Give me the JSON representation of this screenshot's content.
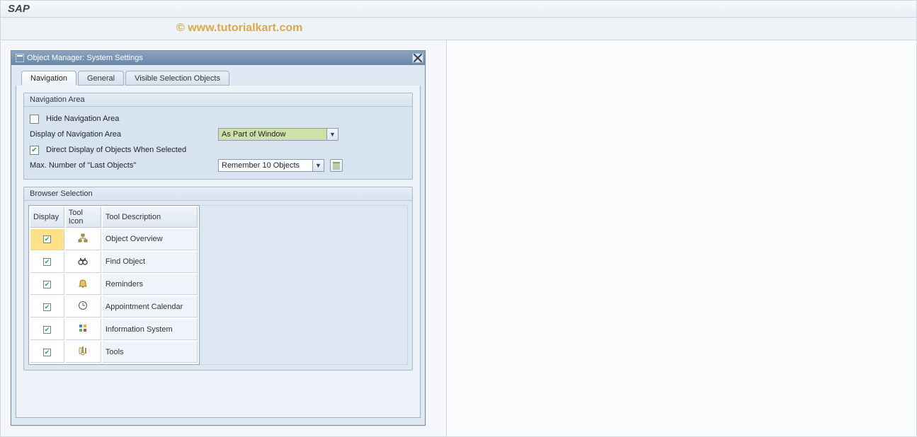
{
  "app_title": "SAP",
  "watermark": "© www.tutorialkart.com",
  "dialog": {
    "title": "Object Manager: System Settings",
    "tabs": {
      "navigation": "Navigation",
      "general": "General",
      "visible_selection": "Visible Selection Objects"
    },
    "nav_area_group": {
      "title": "Navigation Area",
      "hide_nav_label": "Hide Navigation Area",
      "hide_nav_checked": false,
      "display_label": "Display of Navigation Area",
      "display_value": "As Part of Window",
      "direct_display_label": "Direct Display of Objects When Selected",
      "direct_display_checked": true,
      "max_last_label": "Max. Number of \"Last Objects\"",
      "max_last_value": "Remember 10 Objects"
    },
    "browser_group": {
      "title": "Browser Selection",
      "columns": {
        "display": "Display",
        "tool_icon": "Tool Icon",
        "tool_desc": "Tool Description"
      },
      "rows": [
        {
          "checked": true,
          "icon": "hierarchy-icon",
          "desc": "Object Overview",
          "selected": true
        },
        {
          "checked": true,
          "icon": "binoculars-icon",
          "desc": "Find Object",
          "selected": false
        },
        {
          "checked": true,
          "icon": "bell-icon",
          "desc": "Reminders",
          "selected": false
        },
        {
          "checked": true,
          "icon": "clock-icon",
          "desc": "Appointment Calendar",
          "selected": false
        },
        {
          "checked": true,
          "icon": "info-grid-icon",
          "desc": "Information System",
          "selected": false
        },
        {
          "checked": true,
          "icon": "tools-icon",
          "desc": "Tools",
          "selected": false
        }
      ]
    }
  }
}
